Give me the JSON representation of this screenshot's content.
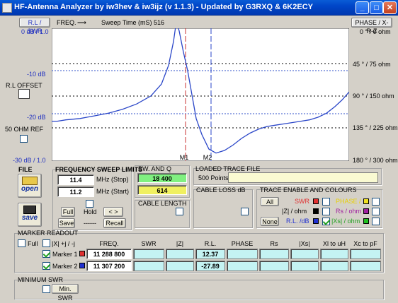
{
  "window": {
    "title": "HF-Antenna Analyzer by iw3hev & iw3ijz  (v 1.1.3) - Updated by G3RXQ & 6K2ECY"
  },
  "header": {
    "rl_swr": "R.L / SWR",
    "freq": "FREQ.",
    "sweep_time": "Sweep Time (mS) 516",
    "phase_xrz": "PHASE / X-R-Z"
  },
  "chart_data": {
    "type": "line",
    "left_labels": [
      "0 dB / 1.0",
      "-10 dB",
      "-20 dB",
      "-30 dB / 1.0"
    ],
    "right_labels": [
      "0 ° / 0 ohm",
      "45 ° / 75 ohm",
      "90 ° / 150 ohm",
      "135 ° / 225 ohm",
      "180 ° / 300 ohm"
    ],
    "marker_labels": [
      "M1",
      "M2"
    ],
    "series": [
      {
        "color": "#2a46c8",
        "values": [
          0.7,
          0.7,
          0.69,
          0.68,
          0.66,
          0.64,
          0.61,
          0.57,
          0.51,
          0.42,
          0.28,
          0.1,
          -0.05,
          0.02,
          0.18,
          0.32,
          0.5,
          0.68,
          0.8,
          0.91,
          0.94,
          0.92,
          0.88,
          0.83,
          0.79,
          0.76,
          0.74,
          0.73,
          0.72,
          0.71,
          0.7,
          0.69,
          0.67,
          0.64,
          0.59,
          0.54,
          0.48
        ]
      }
    ],
    "colors": {
      "grid": "#000",
      "m1": "#c83030",
      "m2": "#2a46c8",
      "rl_gridline": "#3050c8"
    }
  },
  "rl_offset": {
    "label": "R.L OFFSET"
  },
  "ohm_ref": {
    "label": "50 OHM REF"
  },
  "file": {
    "label": "FILE",
    "open": "open",
    "save": "save"
  },
  "sweep": {
    "title": "FREQUENCY SWEEP LIMITS",
    "stop_value": "11.4",
    "stop_unit": "MHz (Stop)",
    "start_value": "11.2",
    "start_unit": "MHz (Start)",
    "full": "Full",
    "hold": "Hold",
    "arrows": "<  >",
    "save": "Save",
    "dashes": "------",
    "recall": "Recall"
  },
  "bw": {
    "title": "BW. AND  Q",
    "bw_value": "18 400",
    "q_value": "614",
    "bw_color": "#80f080",
    "q_color": "#f0f060"
  },
  "cable_length": {
    "title": "CABLE LENGTH"
  },
  "loaded_trace": {
    "title": "LOADED TRACE FILE",
    "points_label": "500  Points"
  },
  "cable_loss": {
    "title": "CABLE LOSS dB"
  },
  "trace_enable": {
    "title": "TRACE ENABLE AND COLOURS",
    "all": "All",
    "none": "None",
    "items": [
      {
        "label": "SWR",
        "color": "#e03030",
        "text_color": "#e03030"
      },
      {
        "label": "PHASE /",
        "color": "#f0e020",
        "text_color": "#e8d000"
      },
      {
        "label": "|Z| / ohm",
        "color": "#000000",
        "text_color": "#000000"
      },
      {
        "label": "Rs / ohm",
        "color": "#a020a0",
        "text_color": "#a020a0"
      },
      {
        "label": "R.L. /dB",
        "color": "#2030d0",
        "text_color": "#2030d0"
      },
      {
        "label": "|Xs| / ohm",
        "color": "#20c020",
        "text_color": "#20a020"
      }
    ]
  },
  "marker_readout": {
    "title": "MARKER READOUT",
    "full": "Full",
    "sign_label": "|X| +j / -j",
    "headers": [
      "FREQ.",
      "SWR",
      "|Z|",
      "R.L.",
      "PHASE",
      "Rs",
      "|Xs|",
      "Xl to uH",
      "Xc to pF"
    ],
    "rows": [
      {
        "label": "Marker 1",
        "color": "#e03030",
        "freq": "11 288 800",
        "rl": "12.37"
      },
      {
        "label": "Marker 2",
        "color": "#2030d0",
        "freq": "11 307 200",
        "rl": "-27.89"
      }
    ]
  },
  "min_swr": {
    "title": "MINIMUM SWR",
    "button": "Min. SWR"
  }
}
